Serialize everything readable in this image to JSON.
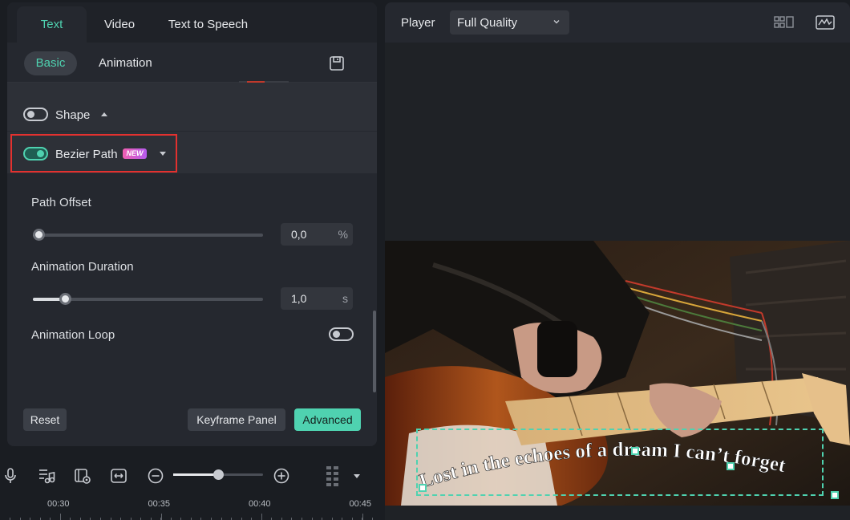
{
  "tabs": {
    "text": "Text",
    "video": "Video",
    "tts": "Text to Speech"
  },
  "subtabs": {
    "basic": "Basic",
    "animation": "Animation"
  },
  "shape": {
    "label": "Shape",
    "enabled": false
  },
  "bezier": {
    "label": "Bezier Path",
    "badge": "NEW",
    "enabled": true
  },
  "path_offset": {
    "label": "Path Offset",
    "value": "0,0",
    "unit": "%",
    "fraction": 0.0
  },
  "animation_duration": {
    "label": "Animation Duration",
    "value": "1,0",
    "unit": "s",
    "fraction": 0.12
  },
  "animation_loop": {
    "label": "Animation Loop",
    "enabled": false
  },
  "buttons": {
    "reset": "Reset",
    "keyframe": "Keyframe Panel",
    "advanced": "Advanced"
  },
  "timeline": {
    "zoom_fraction": 0.5,
    "ticks": [
      "00:30",
      "00:35",
      "00:40",
      "00:45"
    ]
  },
  "player": {
    "label": "Player",
    "quality": "Full Quality"
  },
  "caption": "Lost in the echoes of a dream I can’t forget",
  "colors": {
    "accent": "#4fd2b0",
    "highlight": "#e3312f",
    "panel": "#25282f"
  },
  "icons": {
    "save": "save-icon",
    "mic": "microphone-icon",
    "music": "music-list-icon",
    "clip": "clip-record-icon",
    "fit": "fit-width-icon",
    "zoom_out": "zoom-out-icon",
    "zoom_in": "zoom-in-icon",
    "grid": "grid-handle-icon",
    "layout": "layout-icon",
    "scope": "scope-icon"
  }
}
